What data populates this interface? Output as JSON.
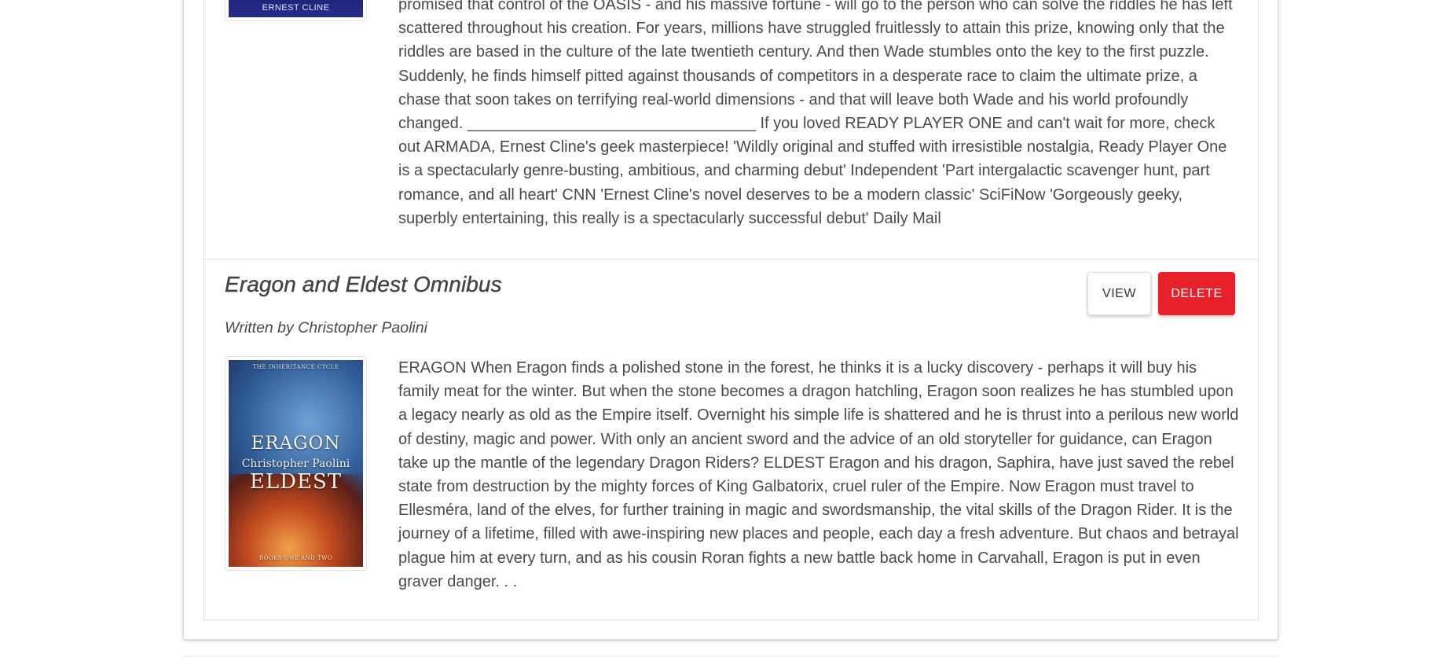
{
  "books": [
    {
      "cover_author_text": "ERNEST CLINE",
      "description": "promised that control of the OASIS - and his massive fortune - will go to the person who can solve the riddles he has left scattered throughout his creation. For years, millions have struggled fruitlessly to attain this prize, knowing only that the riddles are based in the culture of the late twentieth century. And then Wade stumbles onto the key to the first puzzle. Suddenly, he finds himself pitted against thousands of competitors in a desperate race to claim the ultimate prize, a chase that soon takes on terrifying real-world dimensions - and that will leave both Wade and his world profoundly changed. _________________________________ If you loved READY PLAYER ONE and can't wait for more, check out ARMADA, Ernest Cline's geek masterpiece! 'Wildly original and stuffed with irresistible nostalgia, Ready Player One is a spectacularly genre-busting, ambitious, and charming debut' Independent 'Part intergalactic scavenger hunt, part romance, and all heart' CNN 'Ernest Cline's novel deserves to be a modern classic' SciFiNow 'Gorgeously geeky, superbly entertaining, this really is a spectacularly successful debut' Daily Mail"
    },
    {
      "title": "Eragon and Eldest Omnibus",
      "author_line": "Written by Christopher Paolini",
      "view_label": "VIEW",
      "delete_label": "DELETE",
      "cover": {
        "series": "THE INHERITANCE CYCLE",
        "title_a": "ERAGON",
        "author": "Christopher Paolini",
        "title_b": "ELDEST",
        "footer": "BOOKS ONE AND TWO"
      },
      "description": "ERAGON When Eragon finds a polished stone in the forest, he thinks it is a lucky discovery - perhaps it will buy his family meat for the winter. But when the stone becomes a dragon hatchling, Eragon soon realizes he has stumbled upon a legacy nearly as old as the Empire itself. Overnight his simple life is shattered and he is thrust into a perilous new world of destiny, magic and power. With only an ancient sword and the advice of an old storyteller for guidance, can Eragon take up the mantle of the legendary Dragon Riders? ELDEST Eragon and his dragon, Saphira, have just saved the rebel state from destruction by the mighty forces of King Galbatorix, cruel ruler of the Empire. Now Eragon must travel to Ellesméra, land of the elves, for further training in magic and swordsmanship, the vital skills of the Dragon Rider. It is the journey of a lifetime, filled with awe-inspiring new places and people, each day a fresh adventure. But chaos and betrayal plague him at every turn, and as his cousin Roran fights a new battle back home in Carvahall, Eragon is put in even graver danger. . ."
    }
  ],
  "colors": {
    "delete_button": "#e8202a",
    "text": "#4a4a4a",
    "border": "#e0e0e0"
  }
}
